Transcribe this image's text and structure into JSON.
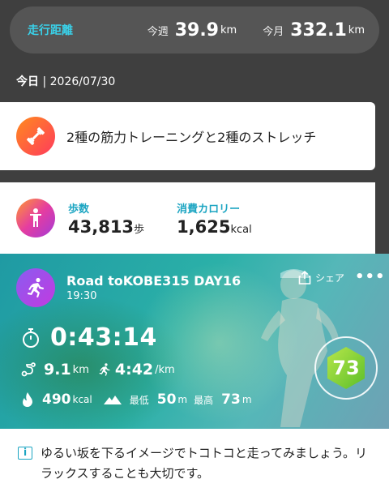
{
  "distance_bar": {
    "label": "走行距離",
    "week_label": "今週",
    "week_value": "39.9",
    "week_unit": "km",
    "month_label": "今月",
    "month_value": "332.1",
    "month_unit": "km"
  },
  "date_bar": {
    "today_label": "今日",
    "separator": "|",
    "date": "2026/07/30"
  },
  "training_card": {
    "icon": "dumbbell-icon",
    "text": "2種の筋力トレーニングと2種のストレッチ"
  },
  "daily_stats": {
    "icon": "person-icon",
    "steps_label": "歩数",
    "steps_value": "43,813",
    "steps_unit": "歩",
    "calories_label": "消費カロリー",
    "calories_value": "1,625",
    "calories_unit": "kcal"
  },
  "activity": {
    "icon": "runner-icon",
    "title": "Road toKOBE315 DAY16",
    "time": "19:30",
    "share_label": "シェア",
    "more_label": "•••",
    "duration": "0:43:14",
    "distance_value": "9.1",
    "distance_unit": "km",
    "pace_value": "4:42",
    "pace_unit": "/km",
    "calories_value": "490",
    "calories_unit": "kcal",
    "min_label": "最低",
    "min_value": "50",
    "min_unit": "m",
    "max_label": "最高",
    "max_value": "73",
    "max_unit": "m",
    "score": "73"
  },
  "note": {
    "icon": "info-icon",
    "text": "ゆるい坂を下るイメージでトコトコと走ってみましょう。リラックスすることも大切です。"
  }
}
